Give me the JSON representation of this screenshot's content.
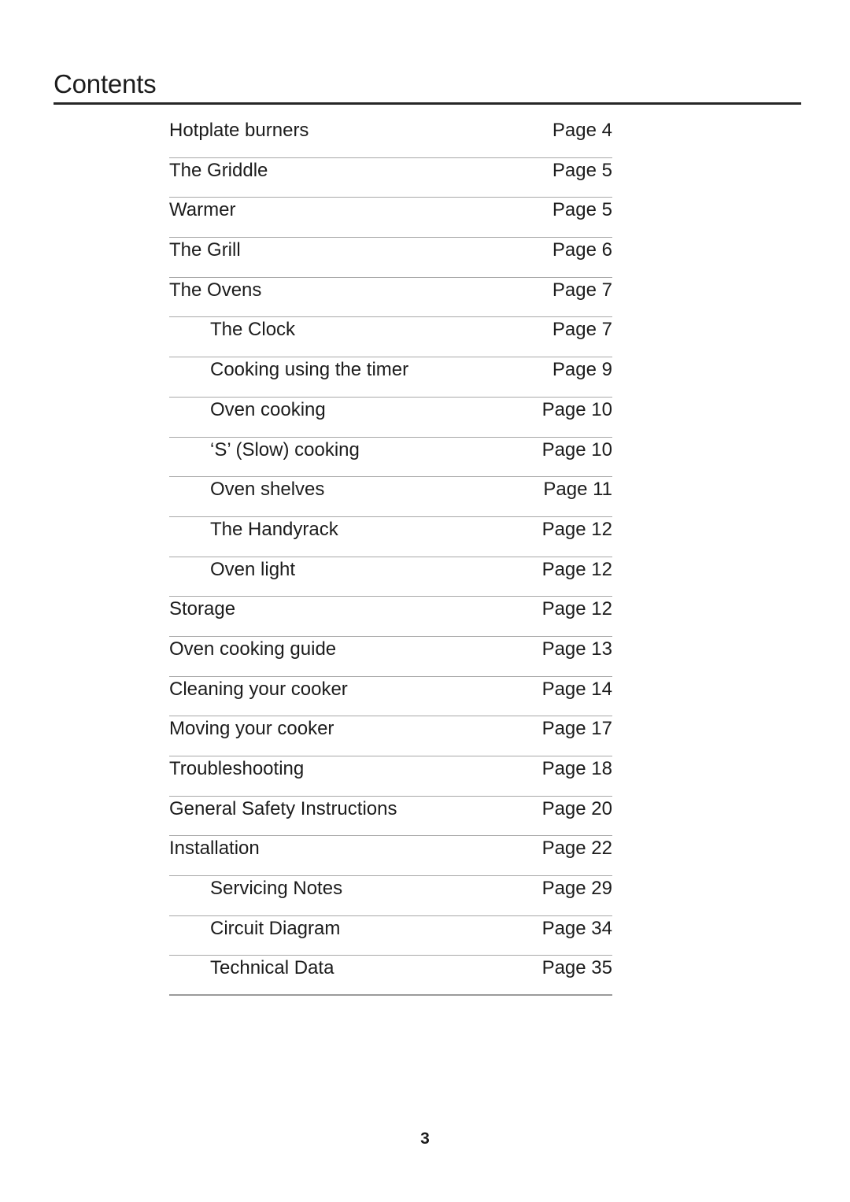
{
  "document": {
    "heading": "Contents",
    "footer_page_number": "3"
  },
  "colors": {
    "text": "#1c1c1c",
    "heading_rule": "#262626",
    "row_rule": "#a8a8a8",
    "background": "#ffffff"
  },
  "contents": {
    "entries": [
      {
        "label": "Hotplate burners",
        "page": "Page 4",
        "level": 1
      },
      {
        "label": "The Griddle",
        "page": "Page 5",
        "level": 1
      },
      {
        "label": "Warmer",
        "page": "Page 5",
        "level": 1
      },
      {
        "label": "The Grill",
        "page": "Page 6",
        "level": 1
      },
      {
        "label": "The Ovens",
        "page": "Page 7",
        "level": 1
      },
      {
        "label": "The Clock",
        "page": "Page 7",
        "level": 2
      },
      {
        "label": "Cooking using the timer",
        "page": "Page 9",
        "level": 2
      },
      {
        "label": "Oven cooking",
        "page": "Page 10",
        "level": 2
      },
      {
        "label": "‘S’ (Slow) cooking",
        "page": "Page 10",
        "level": 2
      },
      {
        "label": "Oven shelves",
        "page": "Page 11",
        "level": 2
      },
      {
        "label": "The Handyrack",
        "page": "Page 12",
        "level": 2
      },
      {
        "label": "Oven light",
        "page": "Page 12",
        "level": 2
      },
      {
        "label": "Storage",
        "page": "Page 12",
        "level": 1
      },
      {
        "label": "Oven cooking guide",
        "page": "Page 13",
        "level": 1
      },
      {
        "label": "Cleaning your cooker",
        "page": "Page 14",
        "level": 1
      },
      {
        "label": "Moving your cooker",
        "page": "Page 17",
        "level": 1
      },
      {
        "label": "Troubleshooting",
        "page": "Page 18",
        "level": 1
      },
      {
        "label": "General Safety Instructions",
        "page": "Page 20",
        "level": 1
      },
      {
        "label": "Installation",
        "page": "Page 22",
        "level": 1
      },
      {
        "label": "Servicing Notes",
        "page": "Page 29",
        "level": 2
      },
      {
        "label": "Circuit Diagram",
        "page": "Page 34",
        "level": 2
      },
      {
        "label": "Technical Data",
        "page": "Page 35",
        "level": 2
      }
    ]
  }
}
